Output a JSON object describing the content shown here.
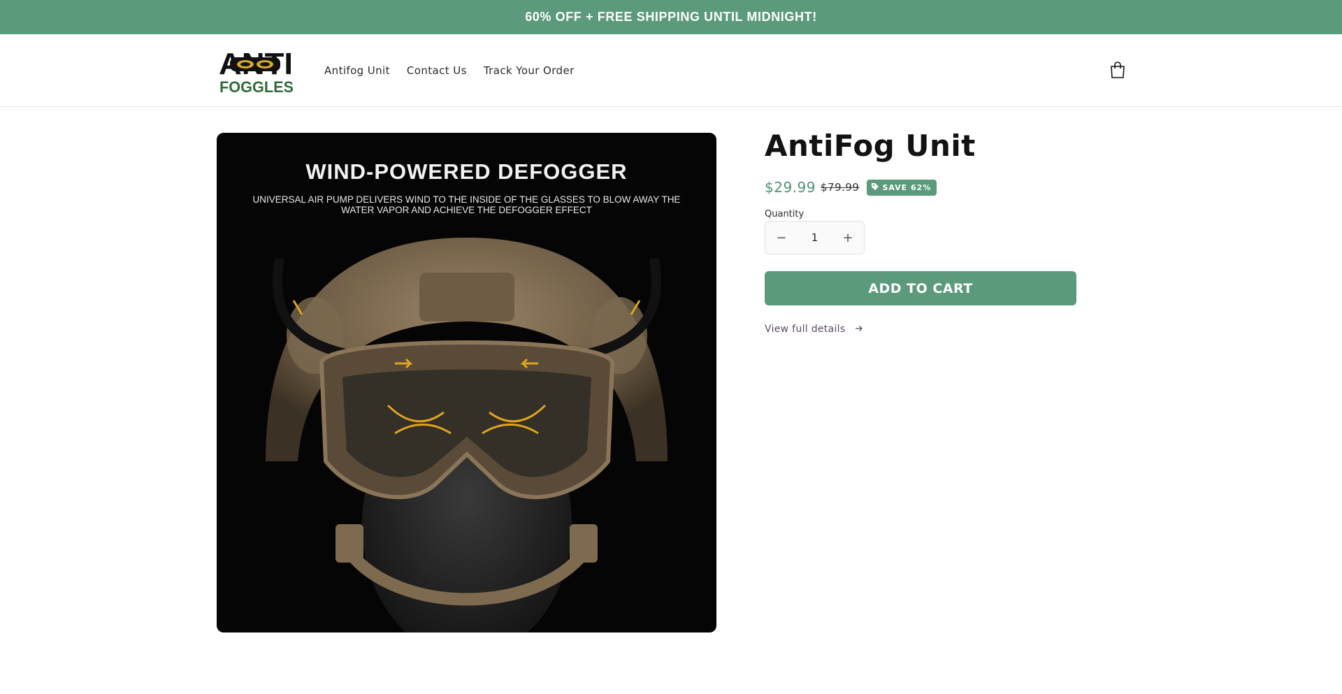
{
  "announcement": {
    "text": "60% OFF + FREE SHIPPING UNTIL MIDNIGHT!"
  },
  "header": {
    "logo": {
      "line1": "ANTI",
      "line2": "FOGGLES"
    },
    "nav": [
      {
        "label": "Antifog Unit"
      },
      {
        "label": "Contact Us"
      },
      {
        "label": "Track Your Order"
      }
    ],
    "cart_icon": "shopping-bag-icon"
  },
  "product": {
    "image": {
      "headline": "WIND-POWERED DEFOGGER",
      "subtext": "UNIVERSAL AIR PUMP DELIVERS WIND TO THE INSIDE OF THE GLASSES TO BLOW AWAY THE WATER VAPOR AND ACHIEVE THE DEFOGGER EFFECT"
    },
    "title": "AntiFog Unit",
    "price_sale": "$29.99",
    "price_regular": "$79.99",
    "save_badge": "SAVE 62%",
    "quantity_label": "Quantity",
    "quantity_value": "1",
    "quantity_minus": "−",
    "quantity_plus": "+",
    "add_to_cart": "ADD TO CART",
    "view_details": "View full details"
  },
  "colors": {
    "accent": "#5b9a7a",
    "price": "#4e9472",
    "logo_green": "#2f6b3a"
  }
}
